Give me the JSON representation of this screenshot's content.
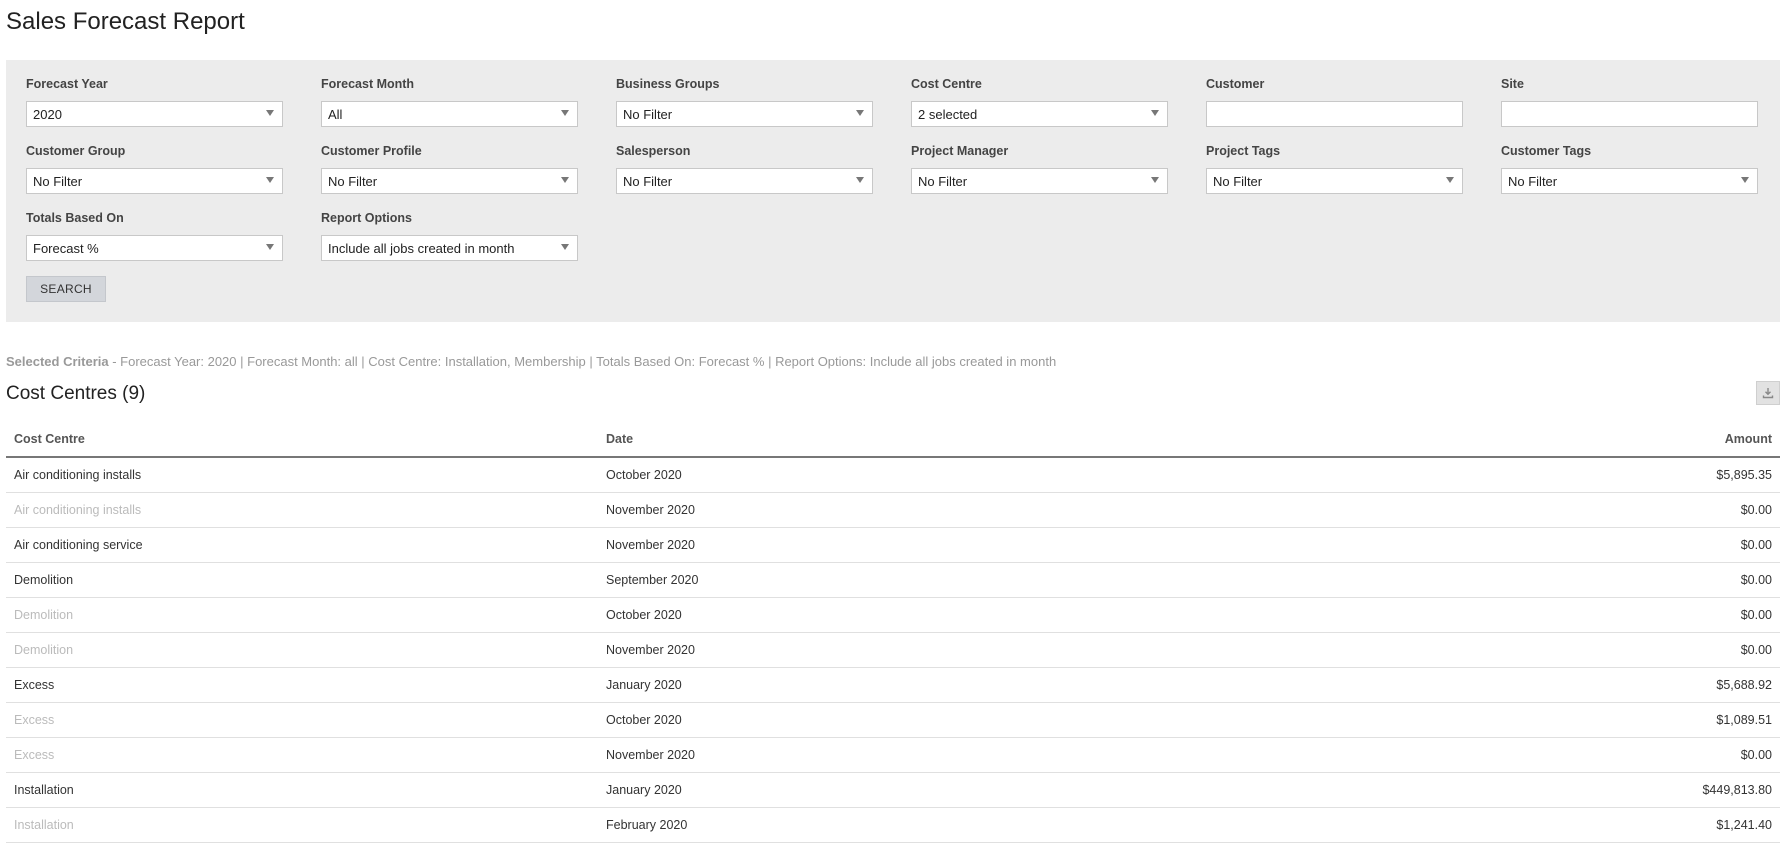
{
  "page_title": "Sales Forecast Report",
  "filters": [
    {
      "label": "Forecast Year",
      "type": "select",
      "value": "2020"
    },
    {
      "label": "Forecast Month",
      "type": "select",
      "value": "All"
    },
    {
      "label": "Business Groups",
      "type": "select",
      "value": "No Filter"
    },
    {
      "label": "Cost Centre",
      "type": "select",
      "value": "2 selected"
    },
    {
      "label": "Customer",
      "type": "text",
      "value": ""
    },
    {
      "label": "Site",
      "type": "text",
      "value": ""
    },
    {
      "label": "Customer Group",
      "type": "select",
      "value": "No Filter"
    },
    {
      "label": "Customer Profile",
      "type": "select",
      "value": "No Filter"
    },
    {
      "label": "Salesperson",
      "type": "select",
      "value": "No Filter"
    },
    {
      "label": "Project Manager",
      "type": "select",
      "value": "No Filter"
    },
    {
      "label": "Project Tags",
      "type": "select",
      "value": "No Filter"
    },
    {
      "label": "Customer Tags",
      "type": "select",
      "value": "No Filter"
    },
    {
      "label": "Totals Based On",
      "type": "select",
      "value": "Forecast %"
    },
    {
      "label": "Report Options",
      "type": "select",
      "value": "Include all jobs created in month"
    }
  ],
  "search_label": "SEARCH",
  "criteria": {
    "label": "Selected Criteria",
    "text": " - Forecast Year: 2020 | Forecast Month: all | Cost Centre: Installation, Membership | Totals Based On: Forecast % | Report Options: Include all jobs created in month"
  },
  "section_title": "Cost Centres (9)",
  "table": {
    "headers": {
      "cost_centre": "Cost Centre",
      "date": "Date",
      "amount": "Amount"
    },
    "rows": [
      {
        "cost_centre": "Air conditioning installs",
        "date": "October 2020",
        "amount": "$5,895.35",
        "group_start": true
      },
      {
        "cost_centre": "Air conditioning installs",
        "date": "November 2020",
        "amount": "$0.00",
        "group_start": false
      },
      {
        "cost_centre": "Air conditioning service",
        "date": "November 2020",
        "amount": "$0.00",
        "group_start": true
      },
      {
        "cost_centre": "Demolition",
        "date": "September 2020",
        "amount": "$0.00",
        "group_start": true
      },
      {
        "cost_centre": "Demolition",
        "date": "October 2020",
        "amount": "$0.00",
        "group_start": false
      },
      {
        "cost_centre": "Demolition",
        "date": "November 2020",
        "amount": "$0.00",
        "group_start": false
      },
      {
        "cost_centre": "Excess",
        "date": "January 2020",
        "amount": "$5,688.92",
        "group_start": true
      },
      {
        "cost_centre": "Excess",
        "date": "October 2020",
        "amount": "$1,089.51",
        "group_start": false
      },
      {
        "cost_centre": "Excess",
        "date": "November 2020",
        "amount": "$0.00",
        "group_start": false
      },
      {
        "cost_centre": "Installation",
        "date": "January 2020",
        "amount": "$449,813.80",
        "group_start": true
      },
      {
        "cost_centre": "Installation",
        "date": "February 2020",
        "amount": "$1,241.40",
        "group_start": false
      }
    ]
  },
  "icons": {
    "download": "download-icon",
    "caret": "chevron-down-icon"
  }
}
